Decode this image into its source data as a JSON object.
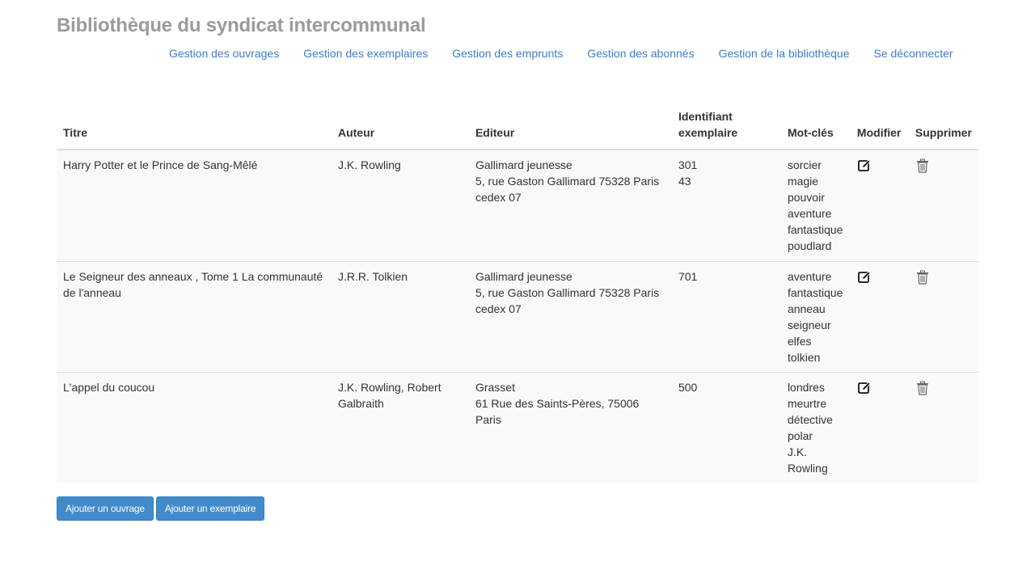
{
  "site": {
    "title": "Bibliothèque du syndicat intercommunal"
  },
  "nav": [
    {
      "label": "Gestion des ouvrages",
      "name": "nav-gestion-ouvrages"
    },
    {
      "label": "Gestion des exemplaires",
      "name": "nav-gestion-exemplaires"
    },
    {
      "label": "Gestion des emprunts",
      "name": "nav-gestion-emprunts"
    },
    {
      "label": "Gestion des abonnés",
      "name": "nav-gestion-abonnes"
    },
    {
      "label": "Gestion de la bibliothèque",
      "name": "nav-gestion-bibliotheque"
    },
    {
      "label": "Se déconnecter",
      "name": "nav-logout"
    }
  ],
  "table": {
    "headers": {
      "titre": "Titre",
      "auteur": "Auteur",
      "editeur": "Editeur",
      "identifiant_line1": "Identifiant",
      "identifiant_line2": "exemplaire",
      "mots": "Mot-clés",
      "modifier": "Modifier",
      "supprimer": "Supprimer"
    },
    "rows": [
      {
        "titre": "Harry Potter et le Prince de Sang-Mêlé",
        "auteur": "J.K. Rowling",
        "editeur_nom": "Gallimard jeunesse",
        "editeur_adresse": "5, rue Gaston Gallimard 75328 Paris cedex 07",
        "identifiants": [
          "301",
          "43"
        ],
        "mots": [
          "sorcier",
          "magie",
          "pouvoir",
          "aventure",
          "fantastique",
          "poudlard"
        ]
      },
      {
        "titre": "Le Seigneur des anneaux , Tome 1 La communauté de l'anneau",
        "auteur": "J.R.R. Tolkien",
        "editeur_nom": "Gallimard jeunesse",
        "editeur_adresse": "5, rue Gaston Gallimard 75328 Paris cedex 07",
        "identifiants": [
          "701"
        ],
        "mots": [
          "aventure",
          "fantastique",
          "anneau",
          "seigneur",
          "elfes",
          "tolkien"
        ]
      },
      {
        "titre": "L'appel du coucou",
        "auteur": "J.K. Rowling, Robert Galbraith",
        "editeur_nom": "Grasset",
        "editeur_adresse": "61 Rue des Saints-Pères, 75006 Paris",
        "identifiants": [
          "500"
        ],
        "mots": [
          "londres",
          "meurtre",
          "détective",
          "polar",
          "J.K. Rowling"
        ]
      }
    ],
    "icons": {
      "modifier": "edit-icon",
      "supprimer": "trash-icon"
    }
  },
  "actions": {
    "add_ouvrage": "Ajouter un ouvrage",
    "add_exemplaire": "Ajouter un exemplaire"
  },
  "colors": {
    "title": "#9b9b9b",
    "link": "#3f7dc7",
    "button": "#428bca",
    "row_bg": "#f9f9f9"
  }
}
